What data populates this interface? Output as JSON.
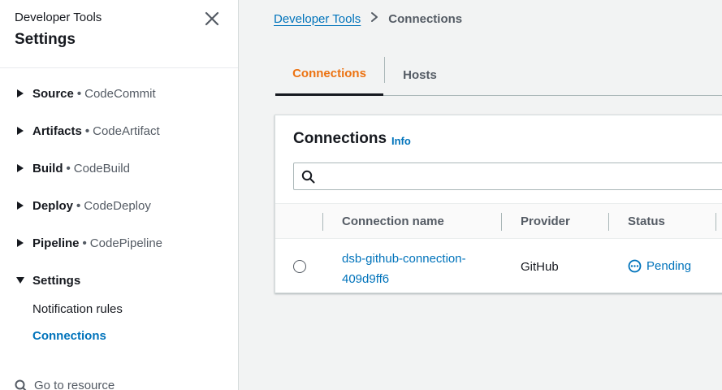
{
  "sidebar": {
    "subtitle": "Developer Tools",
    "title": "Settings",
    "items": [
      {
        "name": "Source",
        "service": "CodeCommit"
      },
      {
        "name": "Artifacts",
        "service": "CodeArtifact"
      },
      {
        "name": "Build",
        "service": "CodeBuild"
      },
      {
        "name": "Deploy",
        "service": "CodeDeploy"
      },
      {
        "name": "Pipeline",
        "service": "CodePipeline"
      }
    ],
    "separator": "•",
    "settings": {
      "label": "Settings",
      "children": [
        "Notification rules",
        "Connections"
      ]
    },
    "goto": "Go to resource"
  },
  "breadcrumb": {
    "parent": "Developer Tools",
    "current": "Connections"
  },
  "tabs": [
    {
      "label": "Connections",
      "active": true
    },
    {
      "label": "Hosts",
      "active": false
    }
  ],
  "panel": {
    "title": "Connections",
    "info": "Info",
    "search_placeholder": ""
  },
  "table": {
    "columns": [
      "Connection name",
      "Provider",
      "Status"
    ],
    "rows": [
      {
        "name": "dsb-github-connection-409d9ff6",
        "provider": "GitHub",
        "status": "Pending"
      }
    ]
  },
  "colors": {
    "accent": "#ec7211",
    "link": "#0073bb",
    "text": "#16191f"
  }
}
